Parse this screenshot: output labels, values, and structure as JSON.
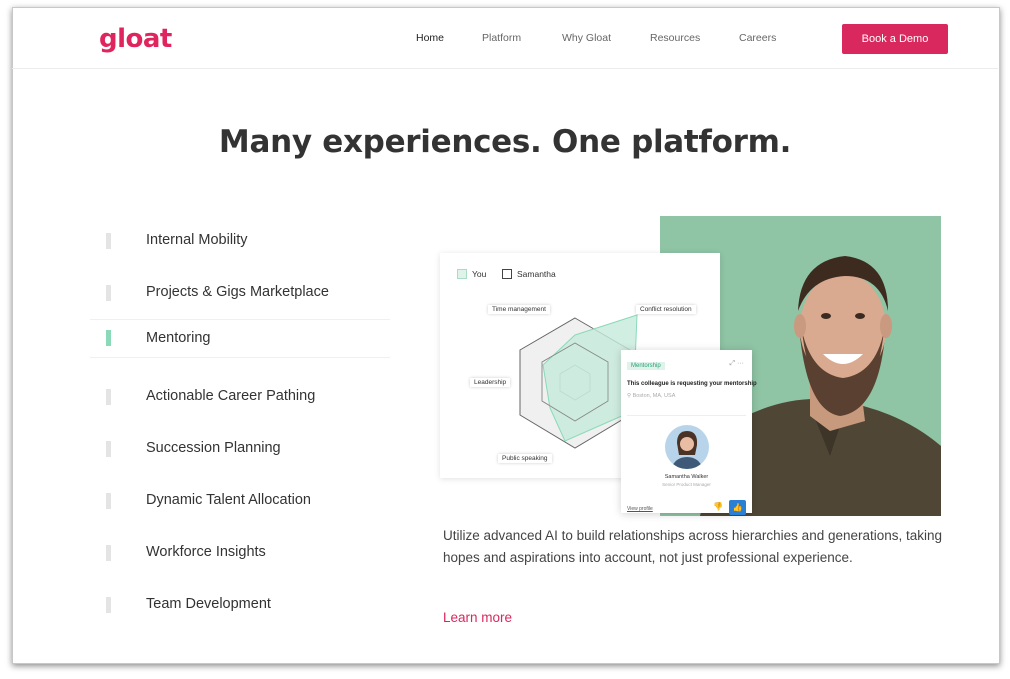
{
  "brand": {
    "logo_text": "gloat",
    "accent": "#d9285d"
  },
  "nav": {
    "items": [
      {
        "label": "Home",
        "active": true
      },
      {
        "label": "Platform"
      },
      {
        "label": "Why Gloat"
      },
      {
        "label": "Resources"
      },
      {
        "label": "Careers"
      }
    ],
    "cta": "Book a Demo"
  },
  "hero": {
    "headline": "Many experiences. One platform."
  },
  "menu": [
    {
      "label": "Internal Mobility"
    },
    {
      "label": "Projects & Gigs Marketplace"
    },
    {
      "label": "Mentoring",
      "active": true
    },
    {
      "label": "Actionable Career Pathing"
    },
    {
      "label": "Succession Planning"
    },
    {
      "label": "Dynamic Talent Allocation"
    },
    {
      "label": "Workforce Insights"
    },
    {
      "label": "Team Development"
    }
  ],
  "radar": {
    "legend": [
      "You",
      "Samantha"
    ],
    "axes": [
      "Time management",
      "Conflict resolution",
      "Leadership",
      "Public speaking"
    ]
  },
  "mentor_card": {
    "tag": "Mentorship",
    "title": "This colleague is requesting your mentorship",
    "location": "Boston, MA, USA",
    "person_name": "Samantha Walker",
    "person_role": "Senior Product Manager",
    "link": "View profile"
  },
  "content": {
    "description": "Utilize advanced AI to build relationships across hierarchies and generations, taking hopes and aspirations into account, not just professional experience.",
    "learn_more": "Learn more"
  }
}
